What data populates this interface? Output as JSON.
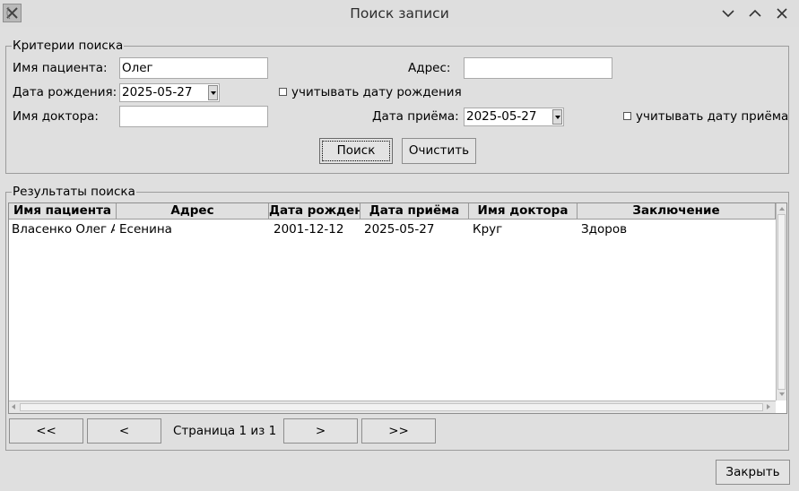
{
  "window": {
    "title": "Поиск записи"
  },
  "criteria": {
    "legend": "Критерии поиска",
    "patient_name_label": "Имя пациента:",
    "patient_name_value": "Олег",
    "address_label": "Адрес:",
    "address_value": "",
    "birth_date_label": "Дата рождения:",
    "birth_date_value": "2025-05-27",
    "use_birth_date_label": "учитывать дату рождения",
    "use_birth_date_checked": false,
    "doctor_name_label": "Имя доктора:",
    "doctor_name_value": "",
    "visit_date_label": "Дата приёма:",
    "visit_date_value": "2025-05-27",
    "use_visit_date_label": "учитывать дату приёма",
    "use_visit_date_checked": false,
    "search_button": "Поиск",
    "clear_button": "Очистить"
  },
  "results": {
    "legend": "Результаты поиска",
    "columns": [
      "Имя пациента",
      "Адрес",
      "Дата рождени",
      "Дата приёма",
      "Имя доктора",
      "Заключение"
    ],
    "rows": [
      [
        "Власенко Олег А",
        "Есенина",
        "2001-12-12",
        "2025-05-27",
        "Круг",
        "Здоров"
      ]
    ]
  },
  "pagination": {
    "first": "<<",
    "prev": "<",
    "page_text": "Страница 1 из 1",
    "next": ">",
    "last": ">>"
  },
  "footer": {
    "close_button": "Закрыть"
  }
}
